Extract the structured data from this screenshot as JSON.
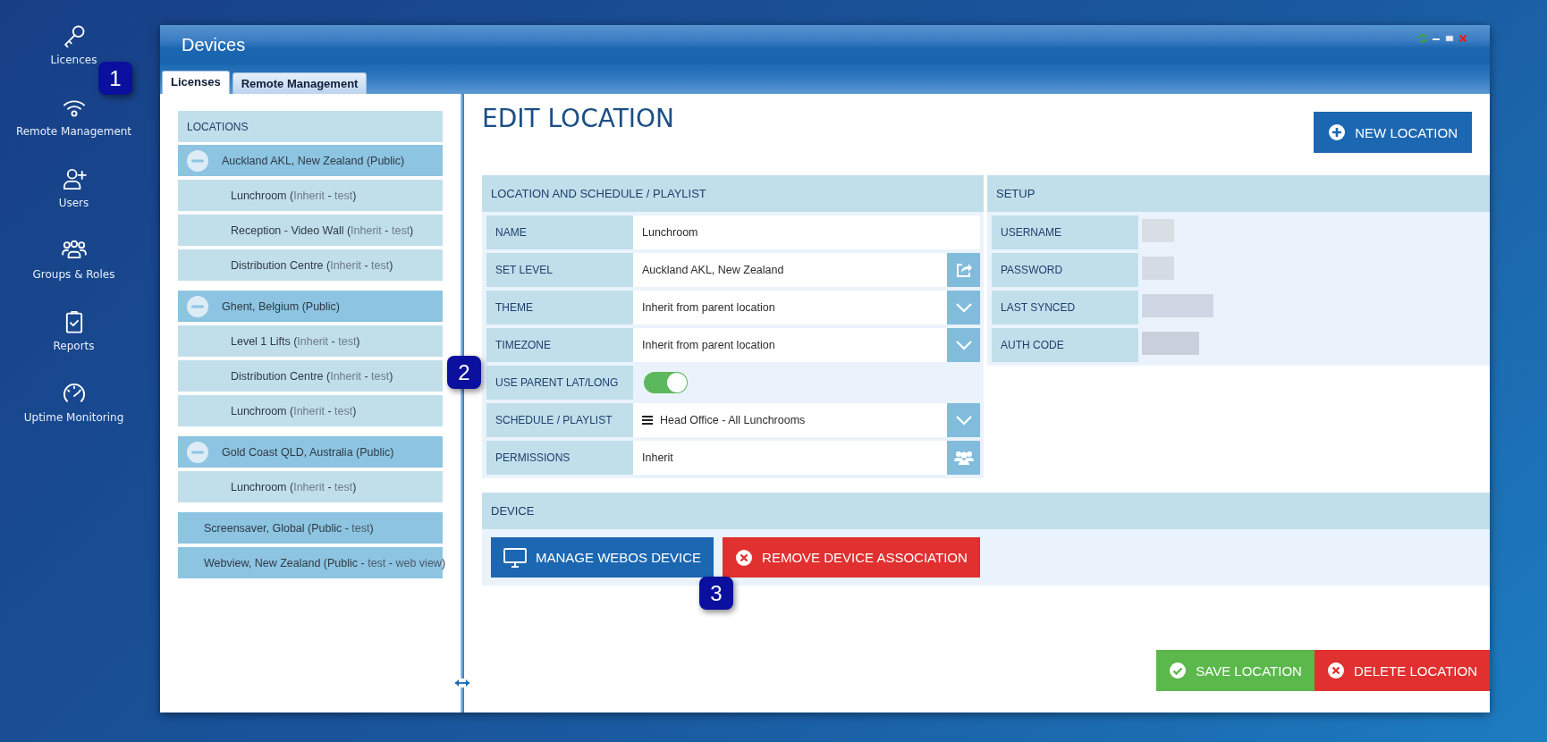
{
  "sidebar": {
    "items": [
      {
        "label": "Licences"
      },
      {
        "label": "Remote Management"
      },
      {
        "label": "Users"
      },
      {
        "label": "Groups & Roles"
      },
      {
        "label": "Reports"
      },
      {
        "label": "Uptime Monitoring"
      }
    ]
  },
  "window": {
    "title": "Devices"
  },
  "tabs": [
    {
      "label": "Licenses",
      "selected": true
    },
    {
      "label": "Remote Management",
      "selected": false
    }
  ],
  "tree": {
    "header": "LOCATIONS",
    "nodes": [
      {
        "expanded": true,
        "segments": [
          {
            "text": "Auckland AKL, New Zealand (Public)",
            "muted": false
          }
        ],
        "children": [
          {
            "segments": [
              {
                "text": "Lunchroom (",
                "muted": false
              },
              {
                "text": "Inherit",
                "muted": true
              },
              {
                "text": " - ",
                "muted": false
              },
              {
                "text": "test",
                "muted": true
              },
              {
                "text": ")",
                "muted": false
              }
            ]
          },
          {
            "segments": [
              {
                "text": "Reception - Video Wall (",
                "muted": false
              },
              {
                "text": "Inherit",
                "muted": true
              },
              {
                "text": " - ",
                "muted": false
              },
              {
                "text": "test",
                "muted": true
              },
              {
                "text": ")",
                "muted": false
              }
            ]
          },
          {
            "segments": [
              {
                "text": "Distribution Centre (",
                "muted": false
              },
              {
                "text": "Inherit",
                "muted": true
              },
              {
                "text": " - ",
                "muted": false
              },
              {
                "text": "test",
                "muted": true
              },
              {
                "text": ")",
                "muted": false
              }
            ]
          }
        ]
      },
      {
        "expanded": true,
        "segments": [
          {
            "text": "Ghent, Belgium (Public)",
            "muted": false
          }
        ],
        "children": [
          {
            "segments": [
              {
                "text": "Level 1 Lifts (",
                "muted": false
              },
              {
                "text": "Inherit",
                "muted": true
              },
              {
                "text": " - ",
                "muted": false
              },
              {
                "text": "test",
                "muted": true
              },
              {
                "text": ")",
                "muted": false
              }
            ]
          },
          {
            "segments": [
              {
                "text": "Distribution Centre (",
                "muted": false
              },
              {
                "text": "Inherit",
                "muted": true
              },
              {
                "text": " - ",
                "muted": false
              },
              {
                "text": "test",
                "muted": true
              },
              {
                "text": ")",
                "muted": false
              }
            ]
          },
          {
            "segments": [
              {
                "text": "Lunchroom (",
                "muted": false
              },
              {
                "text": "Inherit",
                "muted": true
              },
              {
                "text": " - ",
                "muted": false
              },
              {
                "text": "test",
                "muted": true
              },
              {
                "text": ")",
                "muted": false
              }
            ]
          }
        ]
      },
      {
        "expanded": true,
        "segments": [
          {
            "text": "Gold Coast QLD, Australia (Public)",
            "muted": false
          }
        ],
        "children": [
          {
            "segments": [
              {
                "text": "Lunchroom (",
                "muted": false
              },
              {
                "text": "Inherit",
                "muted": true
              },
              {
                "text": " - ",
                "muted": false
              },
              {
                "text": "test",
                "muted": true
              },
              {
                "text": ")",
                "muted": false
              }
            ]
          }
        ]
      },
      {
        "segments": [
          {
            "text": "Screensaver, Global (Public - ",
            "muted": false
          },
          {
            "text": "test",
            "muted": true
          },
          {
            "text": ")",
            "muted": false
          }
        ]
      },
      {
        "segments": [
          {
            "text": "Webview, New Zealand (Public - ",
            "muted": false
          },
          {
            "text": "test",
            "muted": true
          },
          {
            "text": " - ",
            "muted": false
          },
          {
            "text": "web view",
            "muted": true
          },
          {
            "text": ")",
            "muted": false
          }
        ]
      }
    ]
  },
  "edit": {
    "title": "EDIT LOCATION",
    "new_button": {
      "label": "NEW LOCATION",
      "kind": "primary"
    },
    "location_section": {
      "title": "LOCATION AND SCHEDULE / PLAYLIST",
      "fields": [
        {
          "label": "NAME",
          "kind": "text",
          "value": "Lunchroom"
        },
        {
          "label": "SET LEVEL",
          "kind": "picker",
          "value": "Auckland AKL, New Zealand"
        },
        {
          "label": "THEME",
          "kind": "select",
          "value": "Inherit from parent location"
        },
        {
          "label": "TIMEZONE",
          "kind": "select",
          "value": "Inherit from parent location"
        },
        {
          "label": "USE PARENT LAT/LONG",
          "kind": "toggle",
          "on": true
        },
        {
          "label": "SCHEDULE / PLAYLIST",
          "kind": "playlist",
          "value": "Head Office - All Lunchrooms"
        },
        {
          "label": "PERMISSIONS",
          "kind": "permissions",
          "value": "Inherit"
        }
      ]
    },
    "setup_section": {
      "title": "SETUP",
      "fields": [
        {
          "label": "USERNAME",
          "redacted": true
        },
        {
          "label": "PASSWORD",
          "redacted": true
        },
        {
          "label": "LAST SYNCED",
          "redacted": true
        },
        {
          "label": "AUTH CODE",
          "redacted": true
        }
      ]
    },
    "device_section": {
      "title": "DEVICE",
      "buttons": [
        {
          "label": "MANAGE WEBOS DEVICE",
          "kind": "primary"
        },
        {
          "label": "REMOVE DEVICE ASSOCIATION",
          "kind": "danger"
        }
      ]
    },
    "footer_buttons": [
      {
        "label": "SAVE LOCATION",
        "kind": "success"
      },
      {
        "label": "DELETE LOCATION",
        "kind": "danger"
      }
    ]
  },
  "annotations": [
    {
      "text": "1"
    },
    {
      "text": "2"
    },
    {
      "text": "3"
    }
  ]
}
